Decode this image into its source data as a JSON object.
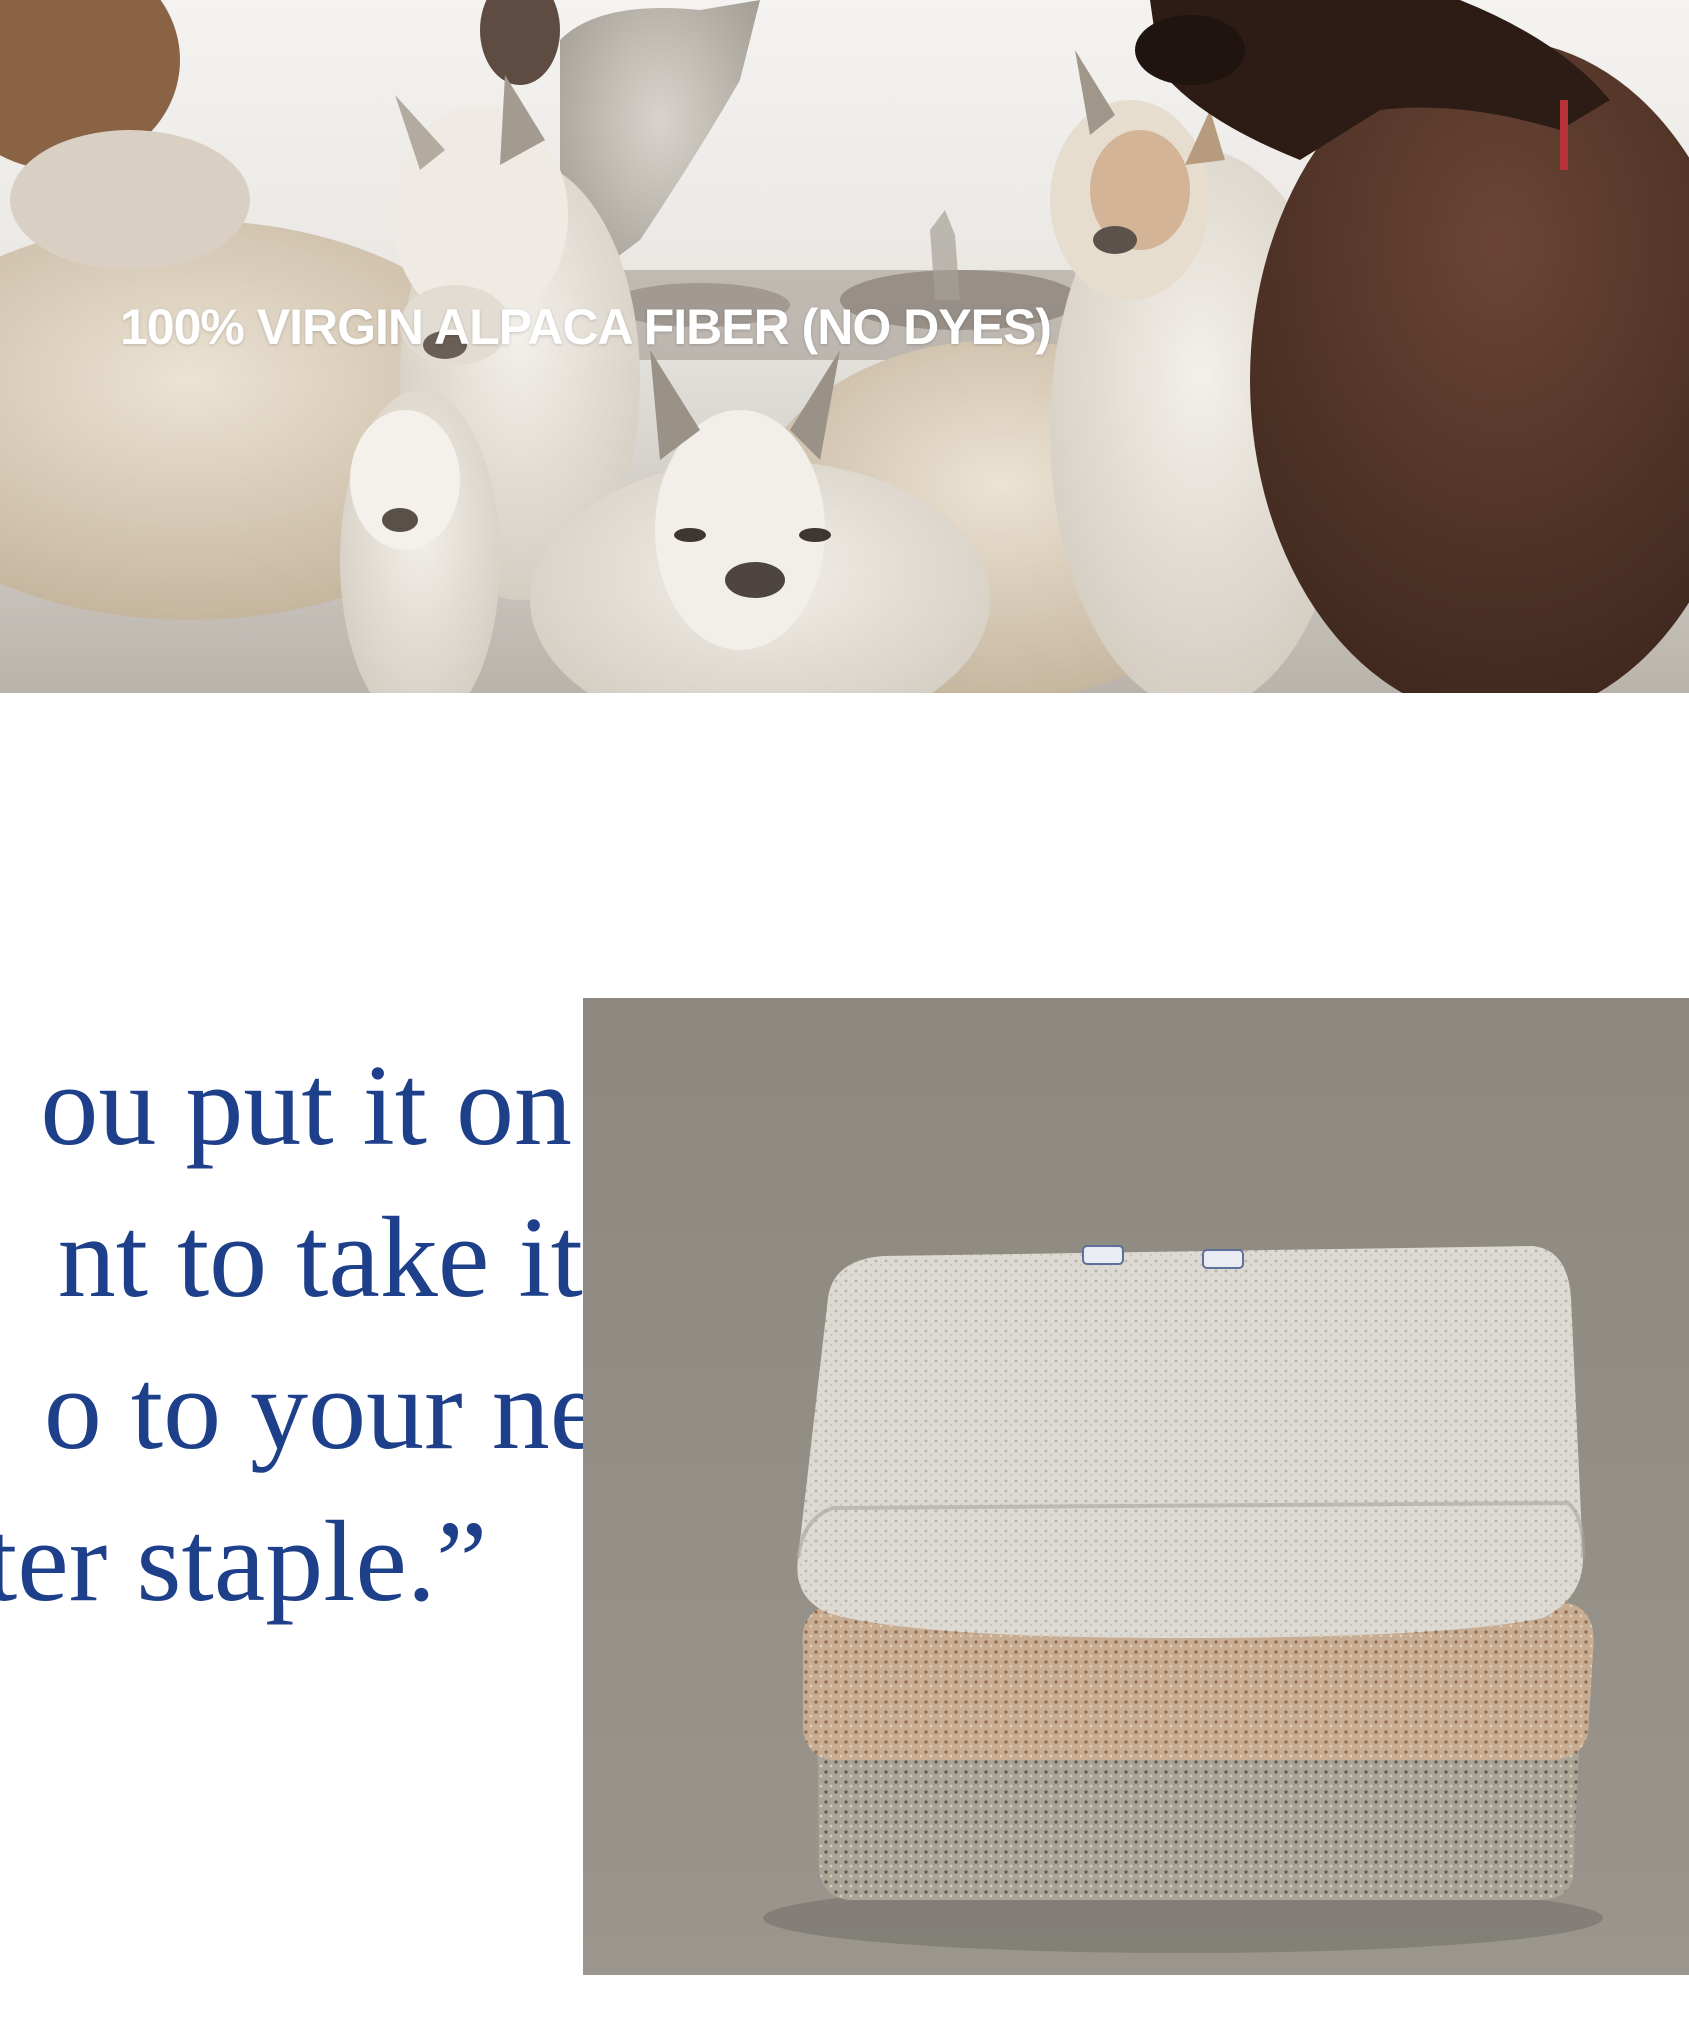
{
  "hero": {
    "caption": "100% VIRGIN ALPACA FIBER (NO DYES)",
    "image_label": "alpaca-herd-photo"
  },
  "quote": {
    "lines": [
      "ou put it on you",
      "nt to take it off",
      "o to your new",
      "ter staple.”"
    ]
  },
  "product_image": {
    "image_label": "folded-alpaca-sweaters-photo"
  },
  "colors": {
    "quote_text": "#1e3f8a",
    "caption_text": "#ffffff",
    "background": "#ffffff"
  }
}
